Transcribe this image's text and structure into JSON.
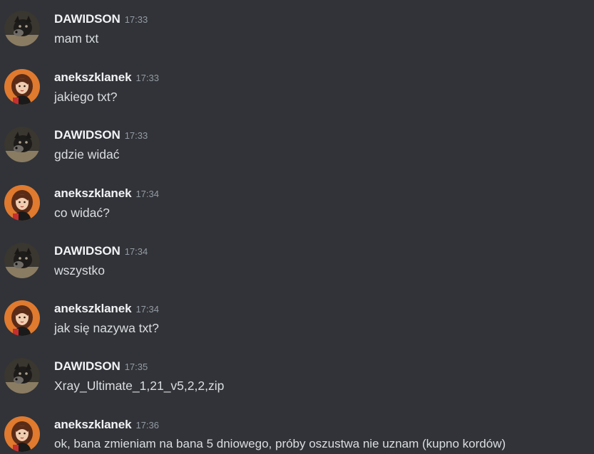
{
  "channel": {
    "messages": [
      {
        "author": "DAWIDSON",
        "time": "17:33",
        "text": "mam txt",
        "avatar": "dog-avatar-icon"
      },
      {
        "author": "anekszklanek",
        "time": "17:33",
        "text": "jakiego txt?",
        "avatar": "girl-avatar-icon"
      },
      {
        "author": "DAWIDSON",
        "time": "17:33",
        "text": "gdzie widać",
        "avatar": "dog-avatar-icon"
      },
      {
        "author": "anekszklanek",
        "time": "17:34",
        "text": "co widać?",
        "avatar": "girl-avatar-icon"
      },
      {
        "author": "DAWIDSON",
        "time": "17:34",
        "text": "wszystko",
        "avatar": "dog-avatar-icon"
      },
      {
        "author": "anekszklanek",
        "time": "17:34",
        "text": "jak się nazywa txt?",
        "avatar": "girl-avatar-icon"
      },
      {
        "author": "DAWIDSON",
        "time": "17:35",
        "text": "Xray_Ultimate_1,21_v5,2,2,zip",
        "avatar": "dog-avatar-icon"
      },
      {
        "author": "anekszklanek",
        "time": "17:36",
        "text": "ok, bana zmieniam na bana 5 dniowego, próby oszustwa nie uznam (kupno kordów)",
        "avatar": "girl-avatar-icon"
      }
    ]
  },
  "theme": {
    "background": "#313338",
    "username_color": "#f2f3f5",
    "text_color": "#dbdee1",
    "timestamp_color": "#949ba4"
  }
}
